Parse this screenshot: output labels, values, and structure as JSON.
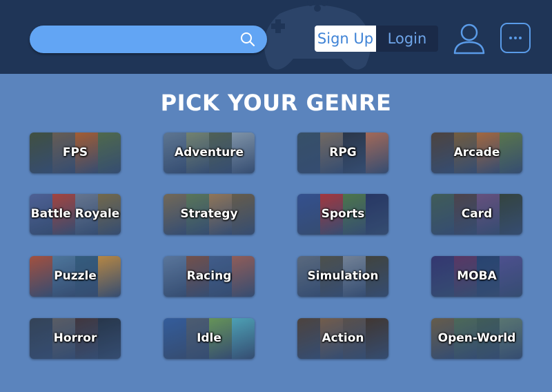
{
  "header": {
    "search": {
      "placeholder": ""
    },
    "signup_label": "Sign Up",
    "login_label": "Login"
  },
  "main": {
    "title": "PICK YOUR GENRE",
    "genres": [
      {
        "label": "FPS",
        "colors": [
          "#4a5a3c",
          "#7a6a55",
          "#c86a2a",
          "#5d7a4a"
        ]
      },
      {
        "label": "Adventure",
        "colors": [
          "#6f8aa3",
          "#8a9a78",
          "#5d6f58",
          "#9ab0c0"
        ]
      },
      {
        "label": "RPG",
        "colors": [
          "#3e5a6e",
          "#8a7a66",
          "#2f3a48",
          "#c87a5a"
        ]
      },
      {
        "label": "Arcade",
        "colors": [
          "#5a4a3a",
          "#8a6a3a",
          "#c8783a",
          "#6a8a4a"
        ]
      },
      {
        "label": "Battle Royale",
        "colors": [
          "#5b6fa8",
          "#c84a3a",
          "#7a8aa0",
          "#8a7a4a"
        ]
      },
      {
        "label": "Strategy",
        "colors": [
          "#8a7a5a",
          "#6a8a5a",
          "#b08a5a",
          "#7a6a4a"
        ]
      },
      {
        "label": "Sports",
        "colors": [
          "#3a5aa0",
          "#c83a3a",
          "#5a8a4a",
          "#2a3a6a"
        ]
      },
      {
        "label": "Card",
        "colors": [
          "#4a6a5a",
          "#5a4a4a",
          "#7a5a8a",
          "#3a4a3a"
        ]
      },
      {
        "label": "Puzzle",
        "colors": [
          "#c85a3a",
          "#5a8ab0",
          "#3a6a8a",
          "#e0a040"
        ]
      },
      {
        "label": "Racing",
        "colors": [
          "#6a8ab0",
          "#8a5a4a",
          "#4a6a9a",
          "#b06a5a"
        ]
      },
      {
        "label": "Simulation",
        "colors": [
          "#6a7a8a",
          "#5a5a4a",
          "#8a9aaa",
          "#4a4a3a"
        ]
      },
      {
        "label": "MOBA",
        "colors": [
          "#3a3a7a",
          "#6a3a6a",
          "#2a4a7a",
          "#5a5aa0"
        ]
      },
      {
        "label": "Horror",
        "colors": [
          "#3a4a5a",
          "#6a6a6a",
          "#4a3a3a",
          "#2a3a4a"
        ]
      },
      {
        "label": "Idle",
        "colors": [
          "#3a6ab0",
          "#5a6a7a",
          "#7ab05a",
          "#5ac0d0"
        ]
      },
      {
        "label": "Action",
        "colors": [
          "#5a4a3a",
          "#8a6a4a",
          "#6a5a4a",
          "#4a3a2a"
        ]
      },
      {
        "label": "Open-World",
        "colors": [
          "#7a6a4a",
          "#5a7a5a",
          "#4a6a5a",
          "#6a8a7a"
        ]
      }
    ]
  },
  "icons": {
    "search": "search-icon",
    "user": "user-icon",
    "more": "more-icon",
    "gamepad": "gamepad-icon"
  }
}
